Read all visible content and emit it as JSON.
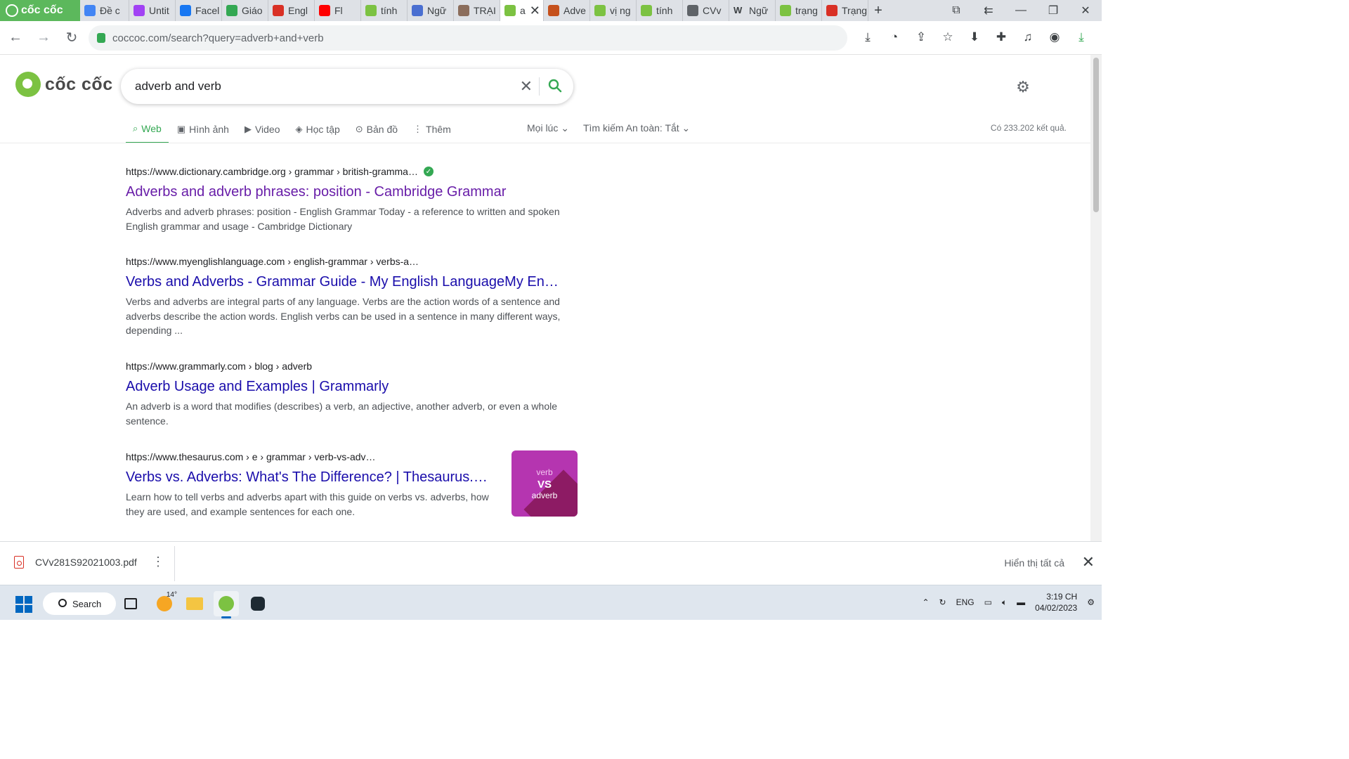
{
  "browser": {
    "brand_tab": "cốc cốc",
    "tabs": [
      {
        "label": "Đề c",
        "color": "#4285f4"
      },
      {
        "label": "Untit",
        "color": "#a142f4"
      },
      {
        "label": "Facel",
        "color": "#1877f2"
      },
      {
        "label": "Giáo",
        "color": "#34a853"
      },
      {
        "label": "Engl",
        "color": "#d93025"
      },
      {
        "label": "Fl",
        "color": "#ff0000"
      },
      {
        "label": "tính",
        "color": "#7cc242"
      },
      {
        "label": "Ngữ",
        "color": "#4a6fd1"
      },
      {
        "label": "TRẠI",
        "color": "#8b6d5c"
      },
      {
        "label": "a",
        "color": "#7cc242",
        "active": true
      },
      {
        "label": "Adve",
        "color": "#c5501c"
      },
      {
        "label": "vị ng",
        "color": "#7cc242"
      },
      {
        "label": "tính",
        "color": "#7cc242"
      },
      {
        "label": "CVv",
        "color": "#5f6368"
      },
      {
        "label": "Ngữ",
        "color": "#202124",
        "glyph": "W"
      },
      {
        "label": "trạng",
        "color": "#7cc242"
      },
      {
        "label": "Trạng",
        "color": "#d93025"
      }
    ],
    "new_tab": "+",
    "url": "coccoc.com/search?query=adverb+and+verb"
  },
  "search": {
    "logo_text": "cốc cốc",
    "query": "adverb and verb",
    "tabs": [
      {
        "label": "Web",
        "icon": "search-icon",
        "glyph": "⌕",
        "active": true
      },
      {
        "label": "Hình ảnh",
        "icon": "image-icon",
        "glyph": "▣"
      },
      {
        "label": "Video",
        "icon": "video-icon",
        "glyph": "▶"
      },
      {
        "label": "Học tập",
        "icon": "graduation-cap-icon",
        "glyph": "◈"
      },
      {
        "label": "Bản đồ",
        "icon": "map-pin-icon",
        "glyph": "⊙"
      },
      {
        "label": "Thêm",
        "icon": "more-vertical-icon",
        "glyph": "⋮"
      }
    ],
    "time_filter": "Mọi lúc",
    "safe_search": "Tìm kiếm An toàn: Tắt",
    "result_count": "Có 233.202 kết quả."
  },
  "results": [
    {
      "url": "https://www.dictionary.cambridge.org › grammar › british-gramma…",
      "verified": true,
      "title": "Adverbs and adverb phrases: position - Cambridge Grammar",
      "visited": true,
      "snippet": "Adverbs and adverb phrases: position - English Grammar Today - a reference to written and spoken English grammar and usage - Cambridge Dictionary"
    },
    {
      "url": "https://www.myenglishlanguage.com › english-grammar › verbs-a…",
      "title": "Verbs and Adverbs - Grammar Guide - My English LanguageMy En…",
      "snippet": "Verbs and adverbs are integral parts of any language. Verbs are the action words of a sentence and adverbs describe the action words. English verbs can be used in a sentence in many different ways, depending ..."
    },
    {
      "url": "https://www.grammarly.com › blog › adverb",
      "title": "Adverb Usage and Examples | Grammarly",
      "snippet": "An adverb is a word that modifies (describes) a verb, an adjective, another adverb, or even a whole sentence."
    },
    {
      "url": "https://www.thesaurus.com › e › grammar › verb-vs-adv…",
      "title": "Verbs vs. Adverbs: What's The Difference? | Thesaurus.…",
      "snippet": "Learn how to tell verbs and adverbs apart with this guide on verbs vs. adverbs, how they are used, and example sentences for each one.",
      "thumb": {
        "top": "verb",
        "mid": "VS",
        "bottom": "adverb"
      }
    }
  ],
  "downloads": {
    "file": "CVv281S92021003.pdf",
    "show_all": "Hiển thị tất cả"
  },
  "taskbar": {
    "search_label": "Search",
    "weather": "14°",
    "language": "ENG",
    "time": "3:19 CH",
    "date": "04/02/2023"
  }
}
